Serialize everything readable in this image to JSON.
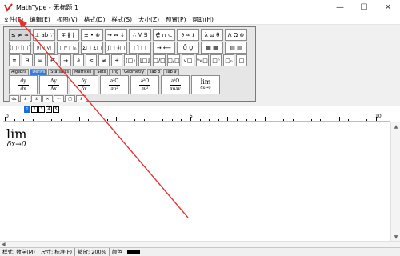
{
  "window": {
    "title": "MathType - 无标题 1",
    "controls": {
      "minimize": "—",
      "maximize": "☐",
      "close": "✕"
    }
  },
  "menu": [
    {
      "label": "文件(F)"
    },
    {
      "label": "编辑(E)"
    },
    {
      "label": "视图(V)"
    },
    {
      "label": "格式(D)"
    },
    {
      "label": "样式(S)"
    },
    {
      "label": "大小(Z)"
    },
    {
      "label": "预置(P)"
    },
    {
      "label": "帮助(H)"
    }
  ],
  "palette": {
    "row1": [
      "≤ ≠ ≈",
      "⊥ ab ∵",
      "∓ ∦ ∥",
      "± • ⊗",
      "→ ⇔ ↓",
      "∴ ∀ ∃",
      "∉ ∩ ⊂",
      "∂ ∞ ℓ",
      "λ ω θ",
      "Λ Ω ⊛"
    ],
    "row2": [
      "(□) [□]",
      "□/□ √□",
      "□ⁿ □ₙ",
      "Σ□ Σ□",
      "∫□ ∮□",
      "□̄ □⃗",
      "→ ⟵",
      "Ů Ų",
      "▦ ▦",
      "▤ ▥"
    ],
    "row3": [
      "π",
      "θ",
      "∞",
      "∈",
      "→",
      "∂",
      "≤",
      "≠",
      "±",
      "(□)",
      "[□]",
      "□/□",
      "□/□",
      "√□",
      "ⁿ√□",
      "□ⁿ",
      "□ₙ",
      "□"
    ],
    "tabs": [
      "Algebra",
      "Derivs",
      "Statistics",
      "Matrices",
      "Sets",
      "Trig",
      "Geometry",
      "Tab 8",
      "Tab 9"
    ],
    "templates": {
      "t1": {
        "num": "dy",
        "den": "dx"
      },
      "t2": {
        "num": "Δy",
        "den": "Δx"
      },
      "t3": {
        "num": "δy",
        "den": "δx"
      },
      "t4": {
        "num": "∂²Ω",
        "den": "∂u²"
      },
      "t5": {
        "num": "∂²Ω",
        "den": "∂v²"
      },
      "t6": {
        "num": "∂²Ω",
        "den": "∂u∂v"
      },
      "t7": {
        "main": "lim",
        "sub": "δx→0"
      }
    },
    "small_row": [
      "dx",
      "ẋ",
      "ẍ",
      "✕",
      "⋯",
      "□̄",
      "x̄"
    ]
  },
  "size_buttons": [
    "1",
    "2",
    "3",
    "4",
    "5"
  ],
  "ruler": {
    "labels": [
      "0",
      "5",
      "10"
    ]
  },
  "editor": {
    "equation": {
      "main": "lim",
      "sub": "δx→0"
    }
  },
  "statusbar": {
    "style": "样式: 数学(M)",
    "size": "尺寸: 标准(F)",
    "zoom": "缩放: 200%",
    "color_label": "颜色",
    "color_value": "#000000"
  },
  "annotation": {
    "arrow_color": "#e8312f"
  }
}
